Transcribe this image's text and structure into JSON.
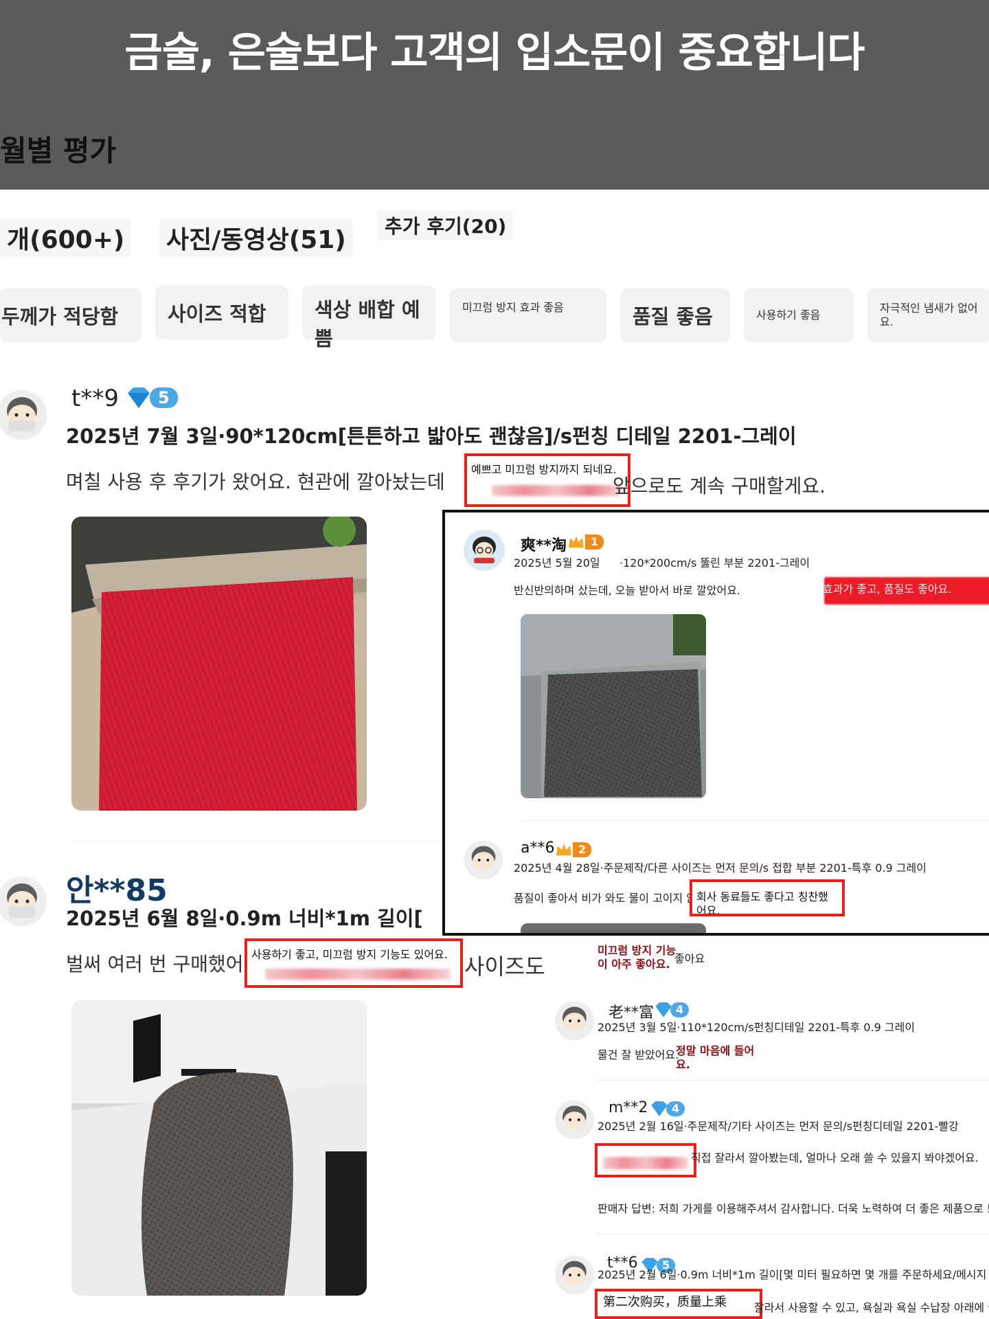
{
  "banner": {
    "title": "금술, 은술보다 고객의 입소문이 중요합니다",
    "section_title": "월별 평가"
  },
  "tabs": [
    {
      "label": "개(600+)"
    },
    {
      "label": "사진/동영상(51)"
    },
    {
      "label": "추가 후기(20)"
    }
  ],
  "chips": [
    {
      "label": "두께가 적당함"
    },
    {
      "label": "사이즈 적합"
    },
    {
      "label": "색상 배합 예쁨"
    },
    {
      "label": "미끄럼 방지 효과 좋음"
    },
    {
      "label": "품질 좋음"
    },
    {
      "label": "사용하기 좋음"
    },
    {
      "label": "자극적인 냄새가 없어요."
    }
  ],
  "reviews": [
    {
      "user": "t**9",
      "level": "5",
      "meta": "2025년 7월 3일·90*120cm[튼튼하고 밟아도 괜찮음]/s펀칭 디테일 2201-그레이",
      "text_before": "며칠 사용 후 후기가 왔어요. 현관에 깔아놨는데",
      "highlight": "예쁘고 미끄럼 방지까지 되네요.",
      "text_after": "앞으로도 계속 구매할게요."
    },
    {
      "user": "안**85",
      "meta": "2025년 6월 8일·0.9m 너비*1m 길이[",
      "text_before": "벌써 여러 번 구매했어요.",
      "highlight": "사용하기 좋고, 미끄럼 방지 기능도 있어요.",
      "text_after": "사이즈도"
    }
  ],
  "overlay": {
    "reviews": [
      {
        "user": "爽**淘",
        "level": "1",
        "date": "2025년 5월 20일",
        "meta": "·120*200cm/s 뚫린 부분 2201-그레이",
        "text": "반신반의하며 샀는데, 오늘 받아서 바로 깔았어요.",
        "highlight": "효과가 좋고, 품질도 좋아요."
      },
      {
        "user": "a**6",
        "level": "2",
        "meta": "2025년 4월 28일·주문제작/다른 사이즈는 먼저 문의/s 접합 부분 2201-특후 0.9 그레이",
        "text": "품질이 좋아서 비가 와도 물이 고이지 않아요.",
        "highlight": "회사 동료들도 좋다고 칭찬했어요."
      }
    ]
  },
  "right_column": {
    "snippet_highlight": "미끄럼 방지 기능이 아주 좋아요.",
    "snippet_text": "좋아요",
    "reviews": [
      {
        "user": "老**富",
        "level": "4",
        "meta": "2025년 3월 5일·110*120cm/s펀칭디테일 2201-특후 0.9 그레이",
        "text": "물건 잘 받았어요.",
        "highlight": "정말 마음에 들어요."
      },
      {
        "user": "m**2",
        "level": "4",
        "meta": "2025년 2월 16일·주문제작/기타 사이즈는 먼저 문의/s펀칭디테일 2201-빨강",
        "text": "직접 잘라서 깔아봤는데, 얼마나 오래 쓸 수 있을지 봐야겠어요.",
        "seller_reply": "판매자 답변: 저희 가게를 이용해주셔서 감사합니다. 더욱 노력하여 더 좋은 제품으로 보"
      },
      {
        "user": "t**6",
        "level": "5",
        "meta": "2025년 2월 6일·0.9m 너비*1m 길이[몇 미터 필요하면 몇 개를 주문하세요/메시지",
        "highlight": "第二次购买，质量上乘",
        "text": "잘라서 사용할 수 있고, 욕실과 욕실 수납장 아래에 놓"
      }
    ]
  },
  "colors": {
    "banner_bg": "#5b5b5b",
    "highlight_border": "#e8201c",
    "diamond_badge": "#4da9e6",
    "crown_badge": "#f08a1c",
    "mat_red": "#d8233a",
    "mat_gray": "#5a5a5a"
  },
  "icons": [
    "diamond-icon",
    "crown-icon",
    "avatar-icon"
  ]
}
